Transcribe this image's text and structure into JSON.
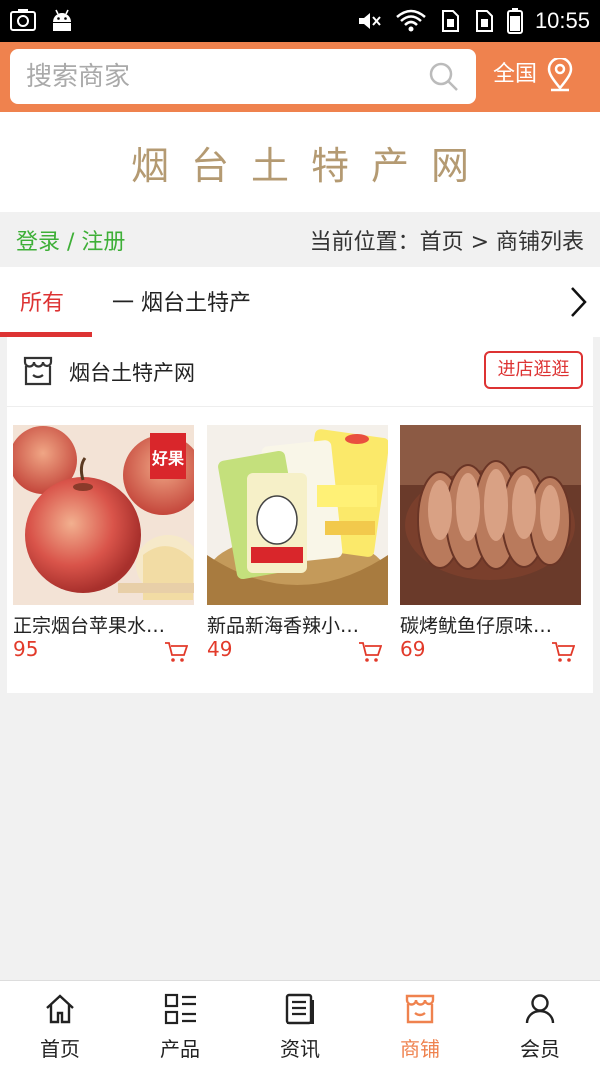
{
  "status_bar": {
    "time": "10:55"
  },
  "search": {
    "placeholder": "搜索商家",
    "region_label": "全国"
  },
  "banner": {
    "title": "烟台土特产网"
  },
  "crumbbar": {
    "login_label": "登录 / 注册",
    "location": "当前位置：首页 > 商铺列表"
  },
  "tabs": {
    "all": "所有",
    "category": "一 烟台土特产"
  },
  "shop": {
    "name": "烟台土特产网",
    "visit_label": "进店逛逛",
    "products": [
      {
        "name": "正宗烟台苹果水…",
        "price": "95",
        "badge": "好果"
      },
      {
        "name": "新品新海香辣小…",
        "price": "49"
      },
      {
        "name": "碳烤鱿鱼仔原味…",
        "price": "69"
      }
    ]
  },
  "tabbar": {
    "items": [
      {
        "label": "首页",
        "icon": "home-icon"
      },
      {
        "label": "产品",
        "icon": "grid-list-icon"
      },
      {
        "label": "资讯",
        "icon": "news-icon"
      },
      {
        "label": "商铺",
        "icon": "store-icon"
      },
      {
        "label": "会员",
        "icon": "user-icon"
      }
    ],
    "active_index": 3
  },
  "colors": {
    "accent": "#ef824e",
    "price": "#e23a2a",
    "login": "#3eaf37",
    "title": "#b49a72"
  }
}
